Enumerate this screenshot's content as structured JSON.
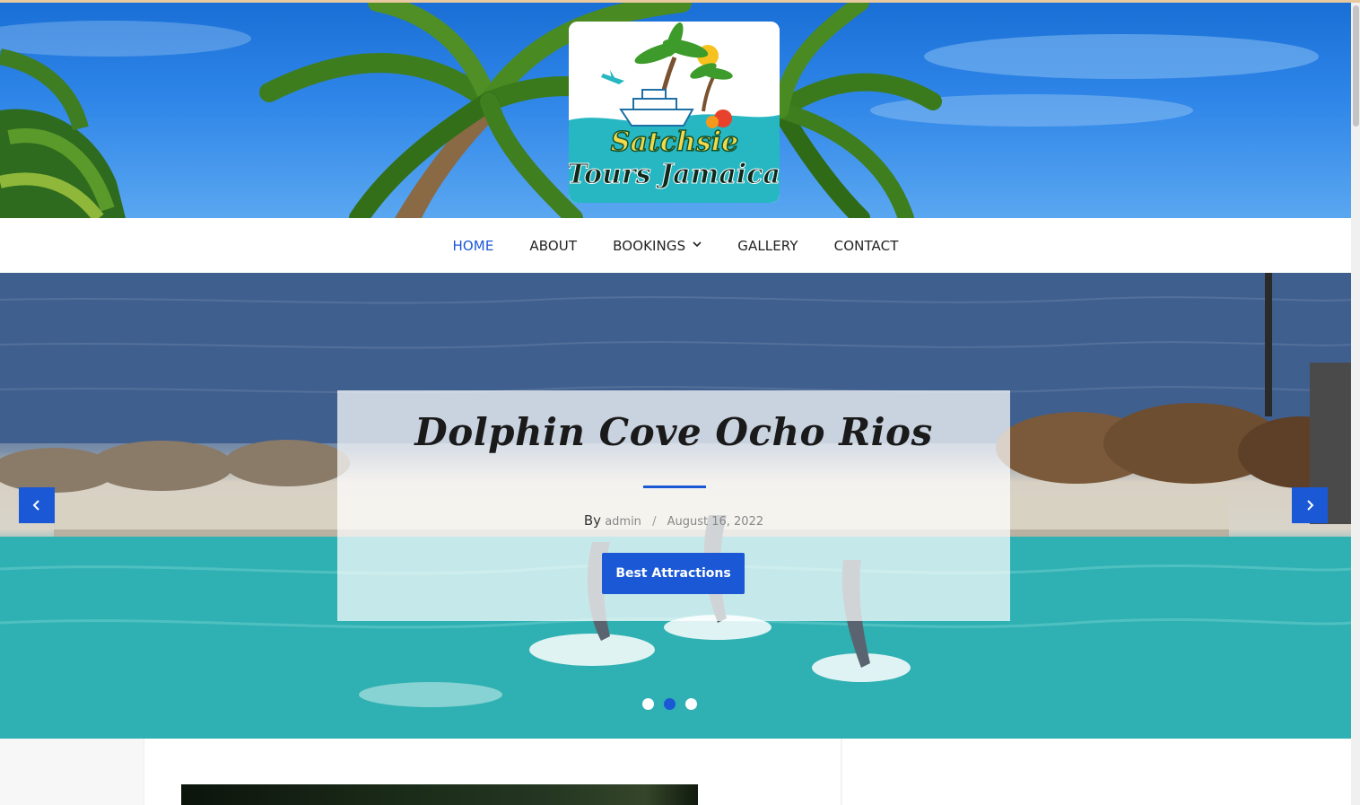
{
  "site": {
    "logo_text_line1": "Satchsie",
    "logo_text_line2": "Tours Jamaica"
  },
  "nav": {
    "items": [
      {
        "label": "HOME",
        "active": true
      },
      {
        "label": "ABOUT",
        "active": false
      },
      {
        "label": "BOOKINGS",
        "active": false,
        "has_dropdown": true
      },
      {
        "label": "GALLERY",
        "active": false
      },
      {
        "label": "CONTACT",
        "active": false
      }
    ]
  },
  "slider": {
    "title": "Dolphin Cove Ocho Rios",
    "by_label": "By",
    "author": "admin",
    "separator": "/",
    "date": "August 16, 2022",
    "button_label": "Best Attractions",
    "prev_icon": "chevron-left-icon",
    "next_icon": "chevron-right-icon",
    "slide_count": 3,
    "active_slide": 2
  },
  "colors": {
    "accent": "#1b58d6",
    "nav_text": "#222222",
    "caption_bg": "rgba(255,255,255,0.72)"
  }
}
